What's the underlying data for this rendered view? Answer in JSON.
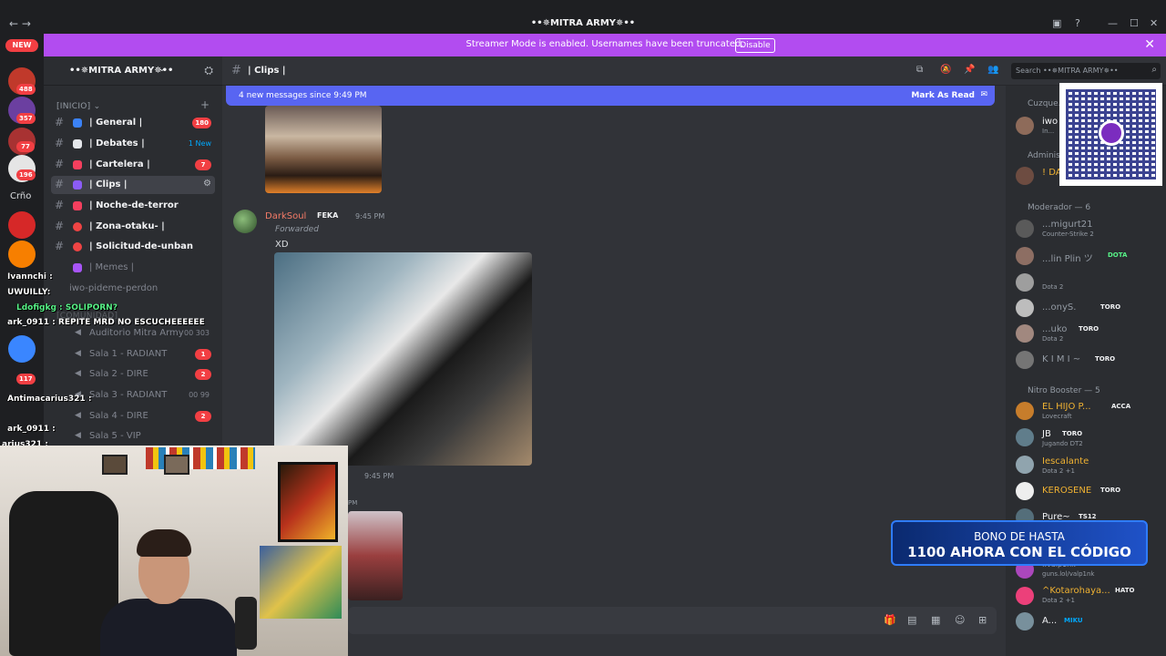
{
  "window": {
    "title": "••✵MITRA ARMY✵••",
    "streamer_banner": "Streamer Mode is enabled. Usernames have been truncated.",
    "banner_button": "Disable"
  },
  "rail": {
    "new_label": "NEW",
    "badges": [
      "488",
      "357",
      "77",
      "196",
      "117"
    ],
    "label": "Crño"
  },
  "guild": {
    "name": "••✵MITRA ARMY✵••",
    "categories": [
      {
        "label": "[INICIO]"
      },
      {
        "label": "[COMUNIDAD]"
      }
    ],
    "channels": [
      {
        "label": "| General |",
        "badge": "180",
        "emoji_color": "#3b82f6"
      },
      {
        "label": "| Debates |",
        "new": "1 New",
        "emoji_color": "#ffffff"
      },
      {
        "label": "| Cartelera |",
        "badge": "7",
        "emoji_color": "#f43f5e"
      },
      {
        "label": "| Clips |",
        "emoji_color": "#8b5cf6"
      },
      {
        "label": "| Noche-de-terror",
        "emoji_color": "#f43f5e"
      },
      {
        "label": "| Zona-otaku- |",
        "emoji_color": "#ef4444"
      },
      {
        "label": "| Solicitud-de-unban",
        "emoji_color": "#ef4444"
      },
      {
        "label": "| Memes |",
        "emoji_color": "#a855f7"
      },
      {
        "label": "iwo-pideme-perdon"
      }
    ],
    "voice": [
      {
        "label": "Auditorio Mitra Army",
        "count": "00 303"
      },
      {
        "label": "Sala 1 - RADIANT",
        "badge": "1"
      },
      {
        "label": "Sala 2 - DIRE",
        "badge": "2"
      },
      {
        "label": "Sala 3 - RADIANT",
        "count": "00 99"
      },
      {
        "label": "Sala 4 - DIRE",
        "badge": "2"
      },
      {
        "label": "Sala 5 - VIP"
      }
    ]
  },
  "header": {
    "channel": "| Clips |",
    "search_placeholder": "Search ••✵MITRA ARMY✵••"
  },
  "chat": {
    "new_messages": "4 new messages since 9:49 PM",
    "mark_read": "Mark As Read",
    "message": {
      "author": "DarkSoul",
      "tag": "FEKA",
      "time": "9:45 PM",
      "forwarded": "Forwarded",
      "text": "XD"
    },
    "time2": "9:45 PM",
    "pm_label": "PM"
  },
  "members": {
    "groups": [
      {
        "label": "Cuzque..."
      },
      {
        "label": "Administ..."
      },
      {
        "label": "Moderador — 6"
      },
      {
        "label": "Nitro Booster — 5"
      }
    ],
    "list": [
      {
        "name": "iwo",
        "status": "In...",
        "color": "#f2f3f5"
      },
      {
        "name": "! DA...",
        "color": "#f0b232"
      },
      {
        "name": "...migurt21",
        "status": "Counter-Strike 2",
        "color": "#949ba4"
      },
      {
        "name": "...lin Plin ツ",
        "tag": "DOTA",
        "color": "#949ba4"
      },
      {
        "name": "",
        "status": "Dota 2",
        "color": "#949ba4"
      },
      {
        "name": "...onyS.",
        "tag": "TORO",
        "color": "#949ba4"
      },
      {
        "name": "...uko",
        "tag": "TORO",
        "status": "Dota 2",
        "color": "#949ba4"
      },
      {
        "name": "K I M I ~",
        "tag": "TORO",
        "color": "#949ba4"
      },
      {
        "name": "EL HIJO P...",
        "tag": "ACCA",
        "status": "Lovecraft",
        "color": "#f0b232"
      },
      {
        "name": "JB",
        "tag": "TORO",
        "status": "Jugando DT2",
        "color": "#f2f3f5"
      },
      {
        "name": "Iescalante",
        "status": "Dota 2 +1",
        "color": "#f0b232"
      },
      {
        "name": "KEROSENE",
        "tag": "TORO",
        "color": "#f0b232"
      },
      {
        "name": "Pure~",
        "tag": "TS12",
        "color": "#f2f3f5"
      },
      {
        "name": "..valp1nk",
        "status": "guns.lol/valp1nk",
        "color": "#949ba4"
      },
      {
        "name": "^Kotarohaya...",
        "tag": "HATO",
        "status": "Dota 2 +1",
        "color": "#f0b232"
      },
      {
        "name": "A...",
        "tag": "MIKU",
        "color": "#f2f3f5"
      }
    ]
  },
  "promo": {
    "line1": "BONO DE HASTA",
    "line2": "1100 AHORA CON EL CÓDIGO"
  },
  "stream_chat": [
    "Ivannchi :",
    "UWUILLY:",
    "Ldofigkg : SOLIPORN?",
    "ark_0911 : REPITE MRD NO ESCUCHEEEEEE",
    "Antimacarius321 :",
    "ark_0911 :",
    "arius321 :"
  ]
}
